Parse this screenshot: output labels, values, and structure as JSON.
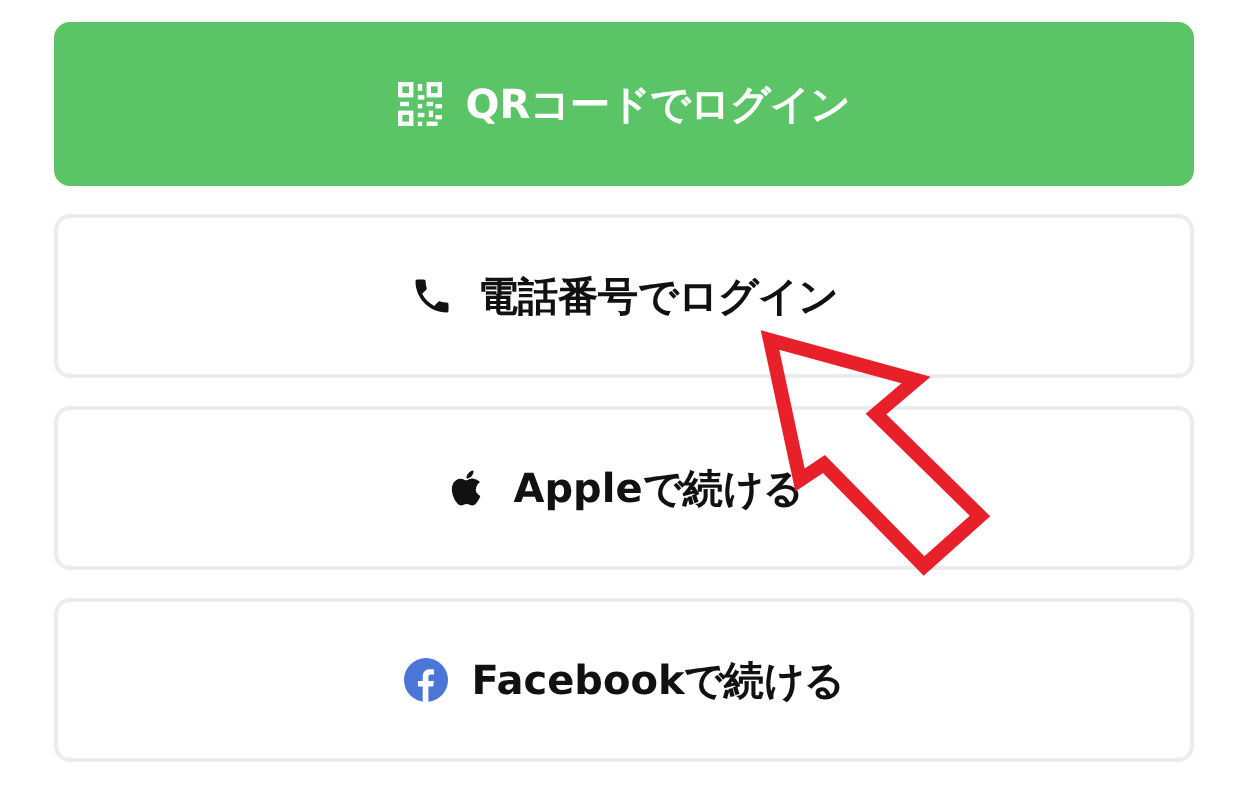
{
  "buttons": [
    {
      "label": "QRコードでログイン",
      "kind": "qr",
      "primary": true
    },
    {
      "label": "電話番号でログイン",
      "kind": "phone",
      "primary": false
    },
    {
      "label": "Appleで続ける",
      "kind": "apple",
      "primary": false
    },
    {
      "label": "Facebookで続ける",
      "kind": "facebook",
      "primary": false
    }
  ]
}
